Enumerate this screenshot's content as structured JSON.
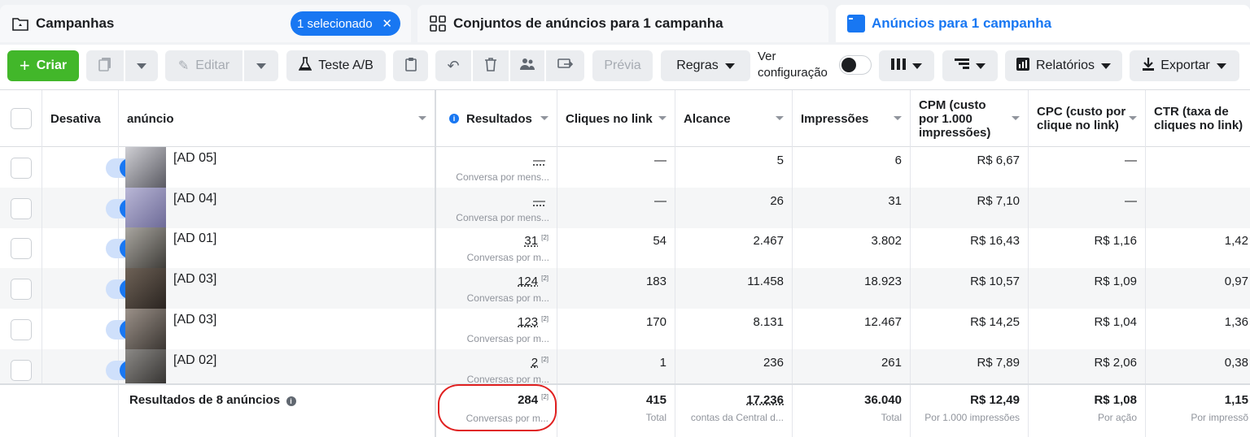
{
  "tabs": {
    "campaigns": "Campanhas",
    "selected_pill": "1 selecionado",
    "adsets": "Conjuntos de anúncios para 1 campanha",
    "ads": "Anúncios para 1 campanha"
  },
  "toolbar": {
    "create": "Criar",
    "edit": "Editar",
    "ab_test": "Teste A/B",
    "preview": "Prévia",
    "rules": "Regras",
    "view_config_line1": "Ver",
    "view_config_line2": "configuração",
    "reports": "Relatórios",
    "export": "Exportar"
  },
  "columns": {
    "status": "Desativa",
    "ad": "anúncio",
    "results": "Resultados",
    "clicks": "Cliques no link",
    "reach": "Alcance",
    "impressions": "Impressões",
    "cpm": [
      "CPM (custo",
      "por 1.000",
      "impressões)"
    ],
    "cpc": [
      "CPC (custo por",
      "clique no link)"
    ],
    "ctr": [
      "CTR (taxa de",
      "cliques no link)"
    ]
  },
  "rows": [
    {
      "name": "[AD 05]",
      "results": "—",
      "results_sub": "Conversa por mens...",
      "results_sup": "",
      "clicks": "—",
      "reach": "5",
      "impressions": "6",
      "cpm": "R$ 6,67",
      "cpc": "—",
      "ctr": ""
    },
    {
      "name": "[AD 04]",
      "results": "—",
      "results_sub": "Conversa por mens...",
      "results_sup": "",
      "clicks": "—",
      "reach": "26",
      "impressions": "31",
      "cpm": "R$ 7,10",
      "cpc": "—",
      "ctr": ""
    },
    {
      "name": "[AD 01]",
      "results": "31",
      "results_sub": "Conversas por m...",
      "results_sup": "[2]",
      "clicks": "54",
      "reach": "2.467",
      "impressions": "3.802",
      "cpm": "R$ 16,43",
      "cpc": "R$ 1,16",
      "ctr": "1,42"
    },
    {
      "name": "[AD 03]",
      "results": "124",
      "results_sub": "Conversas por m...",
      "results_sup": "[2]",
      "clicks": "183",
      "reach": "11.458",
      "impressions": "18.923",
      "cpm": "R$ 10,57",
      "cpc": "R$ 1,09",
      "ctr": "0,97"
    },
    {
      "name": "[AD 03]",
      "results": "123",
      "results_sub": "Conversas por m...",
      "results_sup": "[2]",
      "clicks": "170",
      "reach": "8.131",
      "impressions": "12.467",
      "cpm": "R$ 14,25",
      "cpc": "R$ 1,04",
      "ctr": "1,36"
    },
    {
      "name": "[AD 02]",
      "results": "2",
      "results_sub": "Conversas por m...",
      "results_sup": "[2]",
      "clicks": "1",
      "reach": "236",
      "impressions": "261",
      "cpm": "R$ 7,89",
      "cpc": "R$ 2,06",
      "ctr": "0,38"
    }
  ],
  "totals": {
    "label": "Resultados de 8 anúncios",
    "results": "284",
    "results_sup": "[2]",
    "results_sub": "Conversas por m...",
    "clicks": "415",
    "clicks_sub": "Total",
    "reach": "17.236",
    "reach_sub": "contas da Central d...",
    "impressions": "36.040",
    "impressions_sub": "Total",
    "cpm": "R$ 12,49",
    "cpm_sub": "Por 1.000 impressões",
    "cpc": "R$ 1,08",
    "cpc_sub": "Por ação",
    "ctr": "1,15",
    "ctr_sub": "Por impressõ"
  },
  "colors": {
    "accent": "#1877f2",
    "create": "#42b72a",
    "annotation_ring": "#e02020"
  },
  "icons": [
    "folder-icon",
    "close-icon",
    "grid-icon",
    "ads-window-icon",
    "plus-icon",
    "duplicate-icon",
    "pencil-icon",
    "flask-icon",
    "clipboard-icon",
    "undo-icon",
    "trash-icon",
    "people-icon",
    "share-icon",
    "columns-icon",
    "breakdown-icon",
    "report-icon",
    "download-icon",
    "info-icon"
  ]
}
